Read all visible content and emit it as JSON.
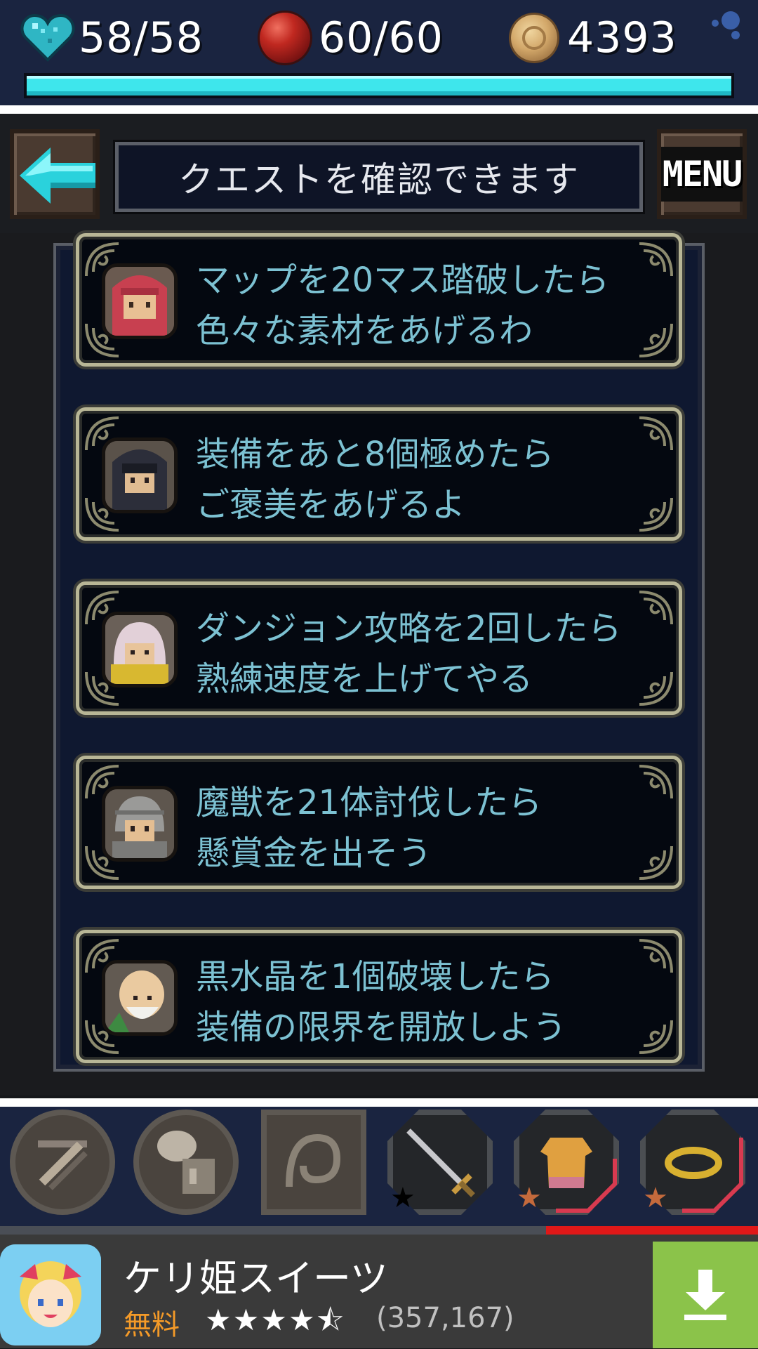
{
  "status": {
    "hp": "58/58",
    "ap": "60/60",
    "coins": "4393",
    "stamina_progress": 1.0,
    "hp_icon": "heart-icon",
    "ap_icon": "red-orb-icon",
    "coin_icon": "coin-icon"
  },
  "header": {
    "title": "クエストを確認できます",
    "back_icon": "back-arrow-icon",
    "menu_label": "MENU"
  },
  "quests": [
    {
      "portrait": "red-hood-girl-portrait",
      "line1": "マップを20マス踏破したら",
      "line2": "色々な素材をあげるわ"
    },
    {
      "portrait": "dark-hood-boy-portrait",
      "line1": "装備をあと8個極めたら",
      "line2": "ご褒美をあげるよ"
    },
    {
      "portrait": "white-hair-old-man-portrait",
      "line1": "ダンジョン攻略を2回したら",
      "line2": "熟練速度を上げてやる"
    },
    {
      "portrait": "helmet-soldier-portrait",
      "line1": "魔獣を21体討伐したら",
      "line2": "懸賞金を出そう"
    },
    {
      "portrait": "bald-elder-portrait",
      "line1": "黒水晶を1個破壊したら",
      "line2": "装備の限界を開放しよう"
    }
  ],
  "toolbar": {
    "slots": [
      {
        "name": "crafting-tools-icon"
      },
      {
        "name": "creature-icon"
      },
      {
        "name": "map-scroll-icon"
      },
      {
        "name": "sword-icon",
        "stars": 1,
        "star_color": "#000000"
      },
      {
        "name": "armor-icon",
        "stars": 1,
        "star_color": "#c46a3c"
      },
      {
        "name": "accessory-icon",
        "stars": 1,
        "star_color": "#c46a3c"
      }
    ],
    "secondary_progress": 0.28
  },
  "ad": {
    "title": "ケリ姫スイーツ",
    "price": "無料",
    "rating_stars": "★★★★⯪",
    "review_count": "(357,167)",
    "download_icon": "download-icon"
  },
  "colors": {
    "quest_text": "#7cc1d2",
    "progress_fill": "#3ee6ec",
    "download_green": "#8bc34a",
    "price_orange": "#f49a28"
  }
}
